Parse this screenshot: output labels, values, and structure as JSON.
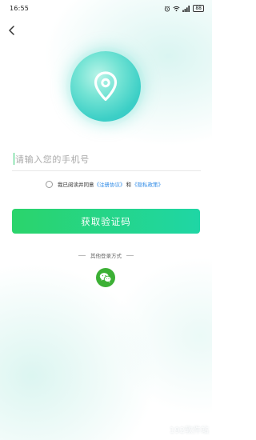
{
  "status_bar": {
    "time": "16:55",
    "battery": "88",
    "icons": [
      "alarm-icon",
      "wifi-icon",
      "signal-icon",
      "battery-icon"
    ]
  },
  "header": {
    "back_icon": "chevron-left-icon"
  },
  "logo": {
    "icon": "location-pin-icon",
    "color": "#3ccfc6"
  },
  "login_form": {
    "phone_placeholder": "请输入您的手机号",
    "phone_value": "",
    "agreement": {
      "prefix": "我已阅读并同意",
      "terms_link": "《注册协议》",
      "conjunction": "和",
      "privacy_link": "《隐私政策》"
    },
    "submit_label": "获取验证码",
    "submit_colors": [
      "#2bd46b",
      "#1fd6a5"
    ]
  },
  "other_login": {
    "label": "其他登录方式",
    "wechat_icon": "wechat-icon",
    "wechat_color": "#3cb035"
  },
  "watermark": "192软件站"
}
